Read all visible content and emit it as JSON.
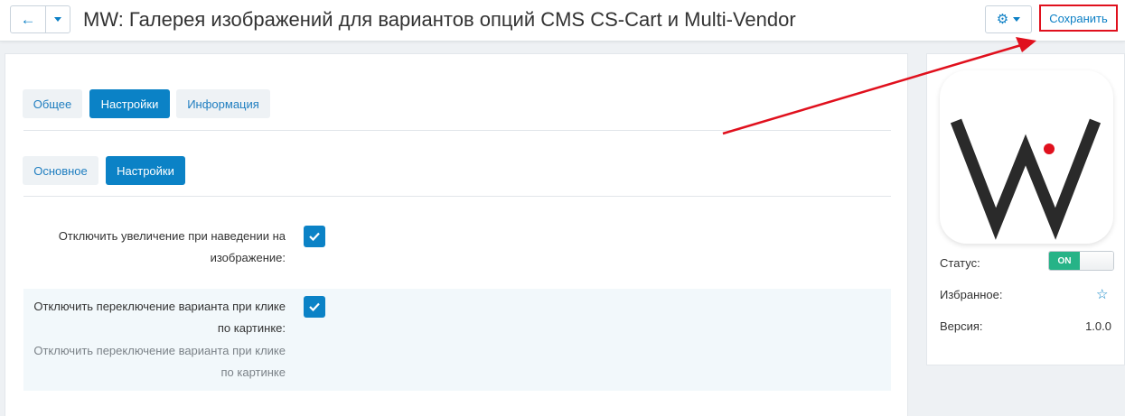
{
  "header": {
    "back_icon": "arrow-left-icon",
    "title": "MW: Галерея изображений для вариантов опций CMS CS-Cart и Multi-Vendor",
    "gear_icon": "gear-icon",
    "save_label": "Сохранить"
  },
  "tabs": [
    {
      "label": "Общее",
      "active": false
    },
    {
      "label": "Настройки",
      "active": true
    },
    {
      "label": "Информация",
      "active": false
    }
  ],
  "subtabs": [
    {
      "label": "Основное",
      "active": false
    },
    {
      "label": "Настройки",
      "active": true
    }
  ],
  "settings": [
    {
      "label_line1": "Отключить увеличение при наведении на",
      "label_line2": "изображение:",
      "checked": true
    },
    {
      "label_line1": "Отключить переключение варианта при клике",
      "label_line2": "по картинке:",
      "checked": true,
      "hint_line1": "Отключить переключение варианта при клике",
      "hint_line2": "по картинке"
    }
  ],
  "sidebar": {
    "status_label": "Статус:",
    "status_toggle": "ON",
    "favorite_label": "Избранное:",
    "favorite_icon": "star-outline-icon",
    "version_label": "Версия:",
    "version_value": "1.0.0"
  },
  "colors": {
    "accent": "#0b82c6",
    "toggle_on": "#26b387",
    "annotation_red": "#e0101d"
  }
}
